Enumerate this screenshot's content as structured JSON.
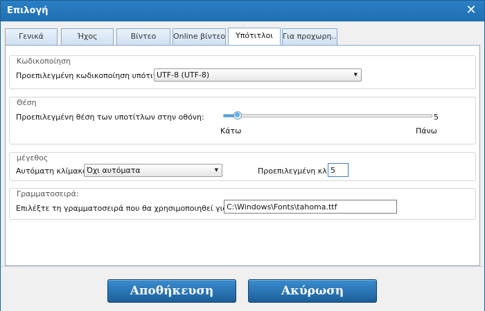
{
  "window": {
    "title": "Επιλογή",
    "close_glyph": "✕",
    "close_icon": "close-icon"
  },
  "tabs": [
    {
      "label": "Γενικά",
      "active": false
    },
    {
      "label": "Ήχος",
      "active": false
    },
    {
      "label": "Βίντεο",
      "active": false
    },
    {
      "label": "Online βίντεο",
      "active": false
    },
    {
      "label": "Υπότιτλοι",
      "active": true
    },
    {
      "label": "Για προχωρη...",
      "active": false
    }
  ],
  "encoding": {
    "group_title": "Κωδικοποίηση",
    "label": "Προεπιλεγμένη κωδικοποίηση υπότιτλου:",
    "selected": "UTF-8 (UTF-8)"
  },
  "position": {
    "group_title": "Θέση",
    "label": "Προεπιλεγμένη θέση των υποτίτλων στην οθόνη:",
    "value": "5",
    "slider_fraction": 0.07,
    "min_label": "Κάτω",
    "max_label": "Πάνω"
  },
  "size": {
    "group_title": "μέγεθος",
    "auto_label": "Αυτόματη κλίμακα:",
    "auto_selected": "Όχι αυτόματα",
    "default_label": "Προεπιλεγμένη κλ...",
    "default_value": "5"
  },
  "font": {
    "group_title": "Γραμματοσειρά:",
    "label": "Επιλέξτε τη γραμματοσειρά που θα χρησιμοποιηθεί για υποτ...",
    "path": "C:\\Windows\\Fonts\\tahoma.ttf"
  },
  "buttons": {
    "save": "Αποθήκευση",
    "cancel": "Ακύρωση"
  },
  "colors": {
    "titlebar": "#1f6fb1",
    "button": "#2a76b8",
    "slider_fill": "#4aa0e6"
  }
}
